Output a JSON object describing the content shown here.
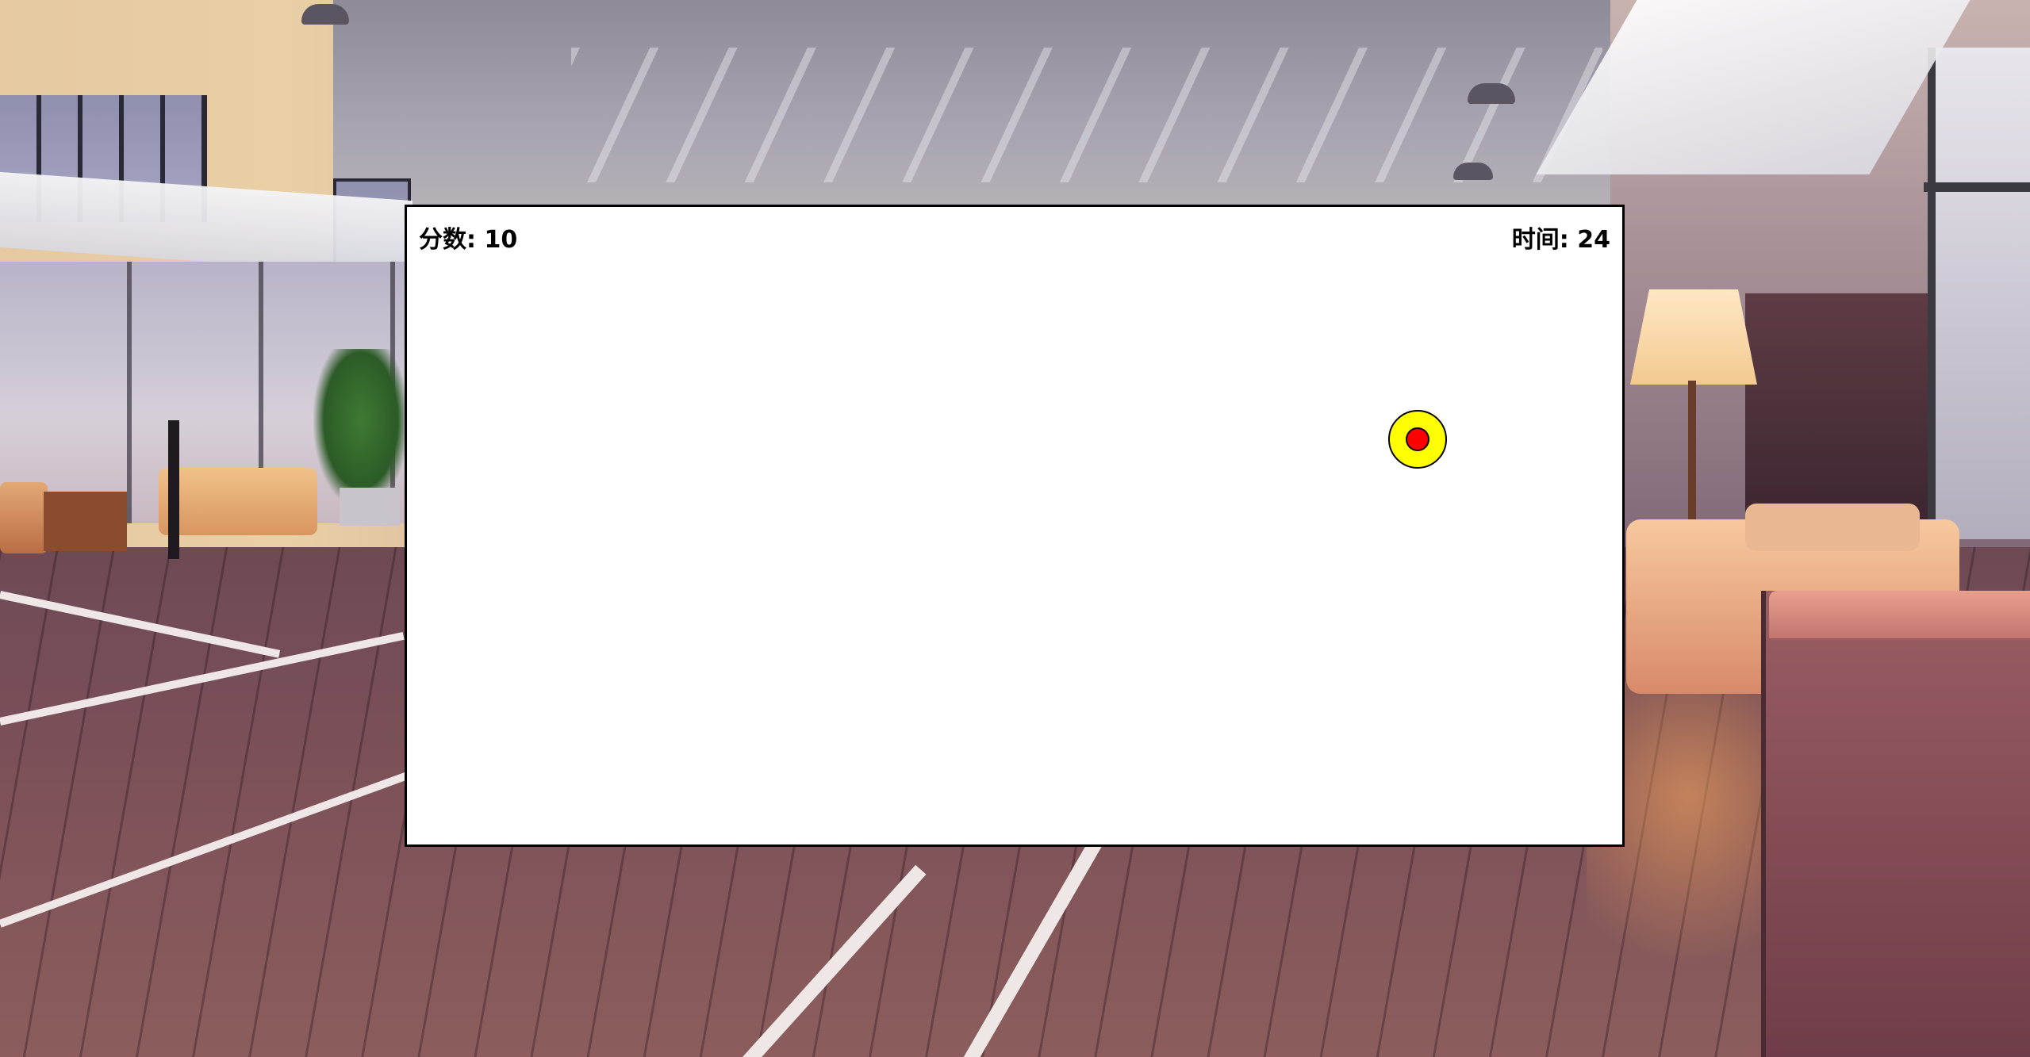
{
  "hud": {
    "score_label": "分数",
    "score_value": "10",
    "time_label": "时间",
    "time_value": "24"
  },
  "target": {
    "outer_color": "#ffff00",
    "inner_color": "#ff0000"
  },
  "board": {
    "background_color": "#ffffff",
    "border_color": "#000000"
  }
}
